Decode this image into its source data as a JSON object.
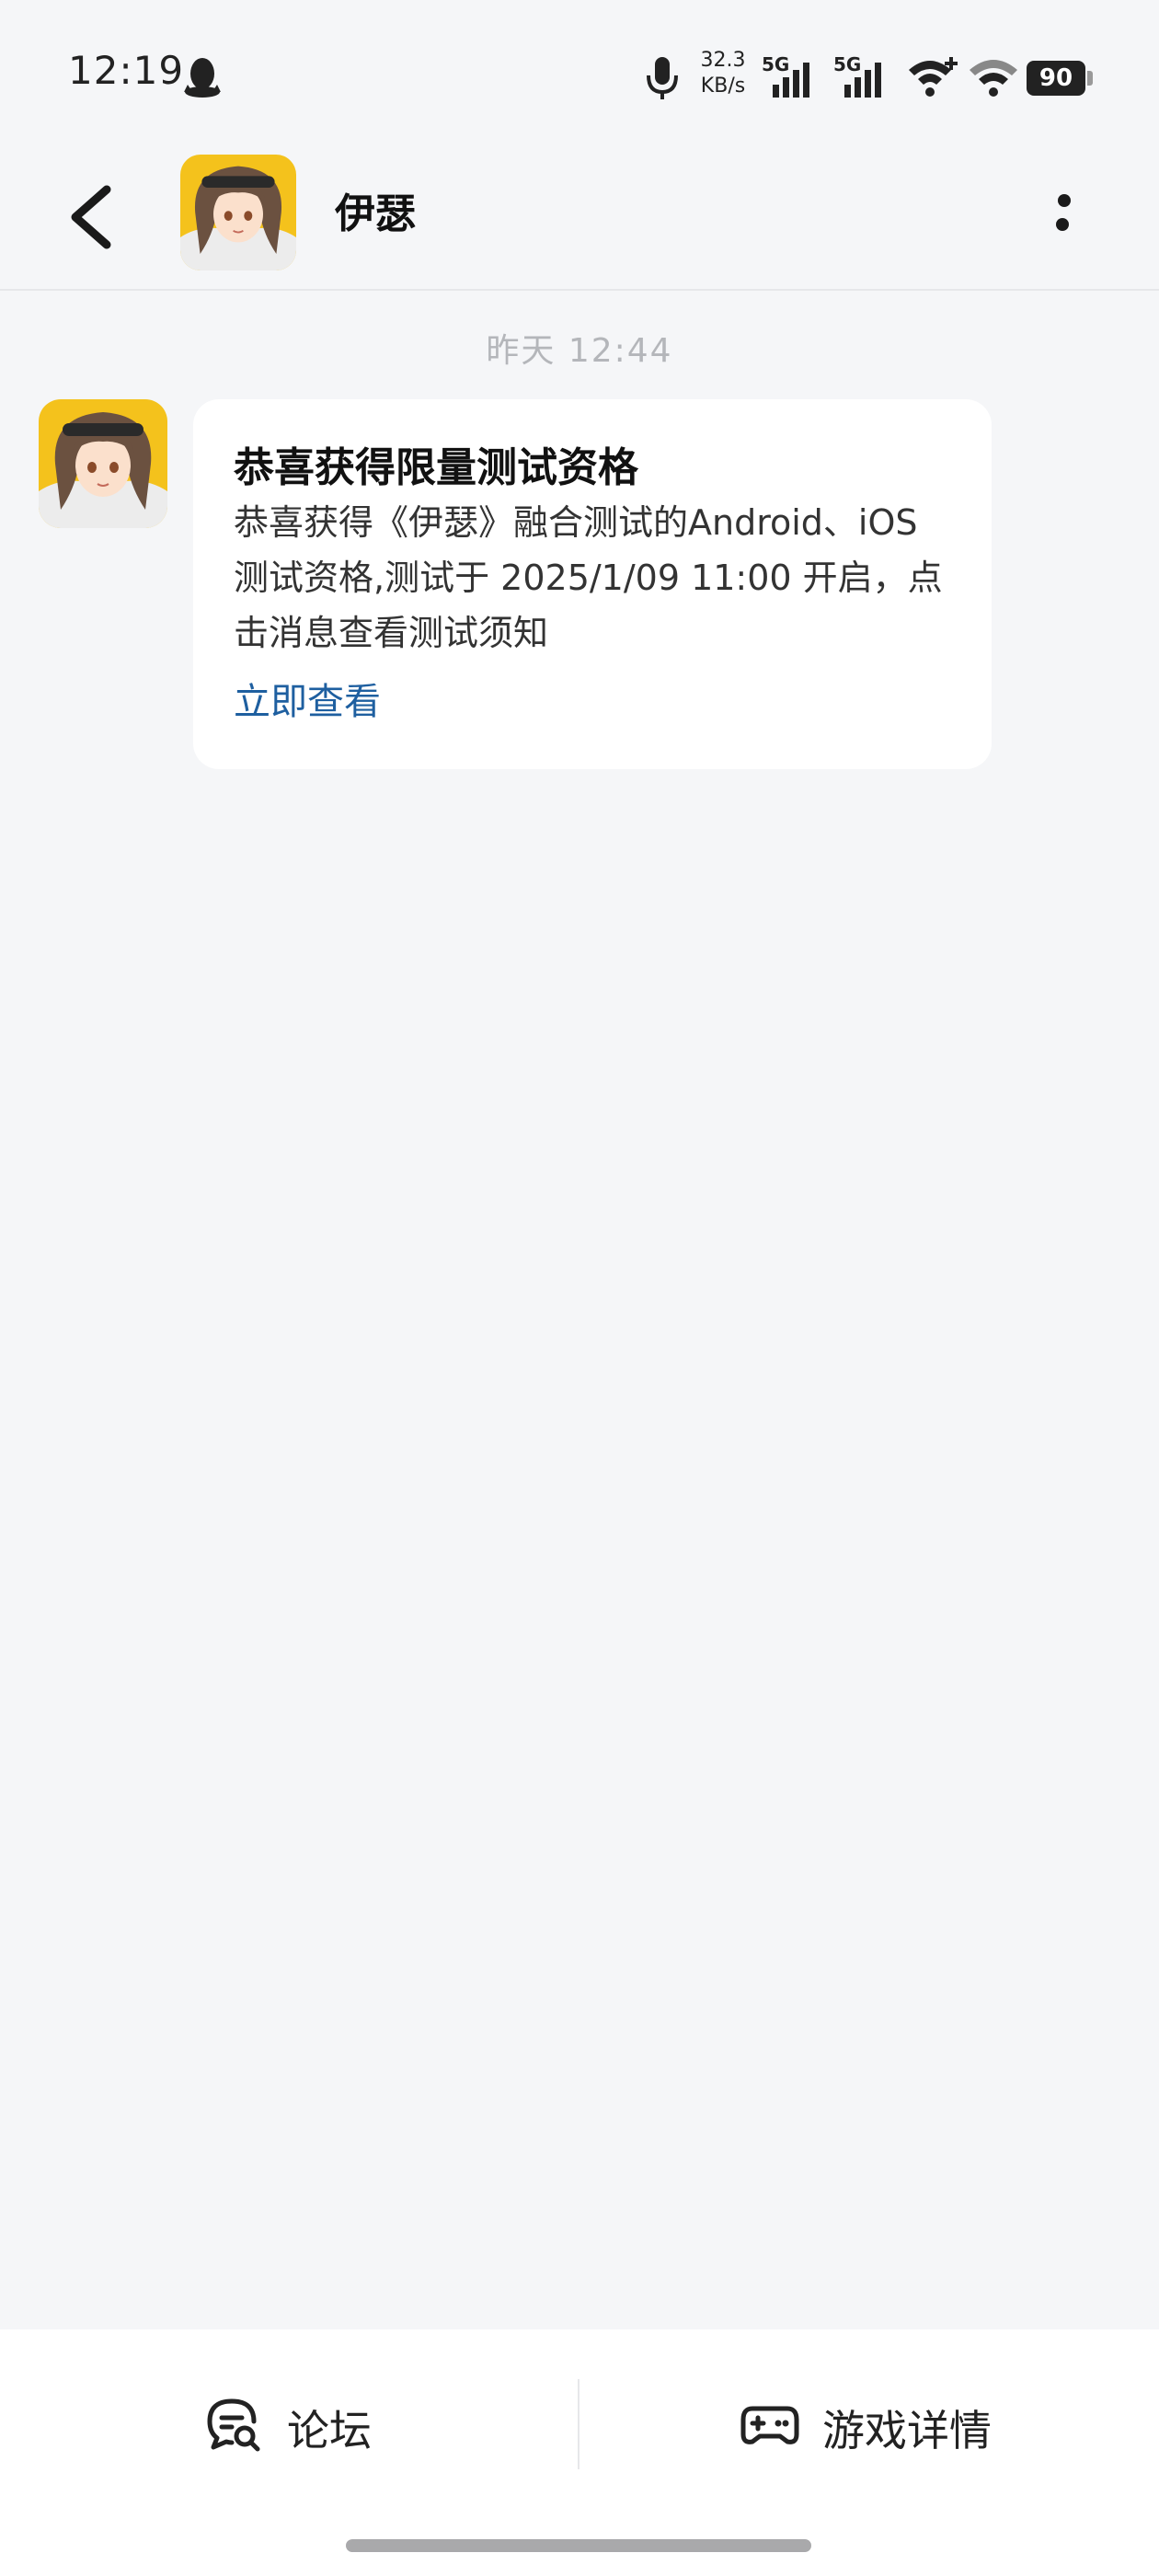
{
  "status_bar": {
    "time": "12:19",
    "net_speed_value": "32.3",
    "net_speed_unit": "KB/s",
    "sim1_label": "5G",
    "sim2_label": "5G",
    "battery": "90"
  },
  "header": {
    "title": "伊瑟",
    "back_icon": "chevron-left-icon",
    "more_icon": "more-vertical-icon"
  },
  "chat": {
    "timestamp": "昨天  12:44",
    "message": {
      "title": "恭喜获得限量测试资格",
      "body": "恭喜获得《伊瑟》融合测试的Android、iOS测试资格,测试于 2025/1/09 11:00 开启，点击消息查看测试须知",
      "link": "立即查看"
    }
  },
  "bottom_bar": {
    "forum_label": "论坛",
    "game_details_label": "游戏详情"
  },
  "colors": {
    "background": "#f5f6f8",
    "link": "#1e5fa0",
    "avatar_bg": "#f4c21c"
  }
}
